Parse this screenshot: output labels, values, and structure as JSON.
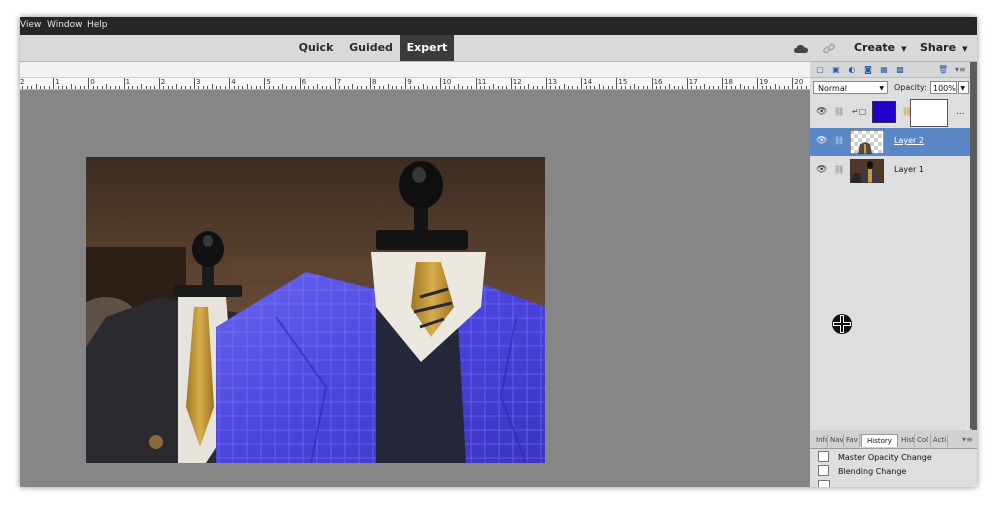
{
  "menu": [
    "View",
    "Window",
    "Help"
  ],
  "modes": {
    "quick": "Quick",
    "guided": "Guided",
    "expert": "Expert"
  },
  "top_actions": {
    "create": "Create",
    "share": "Share"
  },
  "ruler_labels": [
    "2",
    "1",
    "0",
    "1",
    "2",
    "3",
    "4",
    "5",
    "6",
    "7",
    "8",
    "9",
    "10",
    "11",
    "12",
    "13",
    "14",
    "15",
    "16",
    "17",
    "18",
    "19",
    "20"
  ],
  "layers_panel": {
    "blend_mode": "Normal",
    "opacity_label": "Opacity:",
    "opacity_value": "100%",
    "more": "...",
    "layers": [
      {
        "name": "",
        "type": "adjustment"
      },
      {
        "name": "Layer 2",
        "selected": true
      },
      {
        "name": "Layer 1",
        "selected": false
      }
    ]
  },
  "history_panel": {
    "close": "×",
    "tabs": [
      "Info",
      "Nav",
      "Fav",
      "History",
      "Hist",
      "Col",
      "Acti"
    ],
    "active_tab": "History",
    "items": [
      "Master Opacity Change",
      "Blending Change"
    ]
  },
  "icons": {
    "cloud": "cloud-icon",
    "link": "link-icon",
    "eye": "eye-icon",
    "trash": "trash-icon",
    "panel_menu": "panel-menu-icon"
  },
  "colors": {
    "menubar": "#262626",
    "modebar": "#d9d9d9",
    "active_mode": "#3b3b3b",
    "canvas": "#868686",
    "selected_layer": "#5a87c5",
    "fill_color": "#2200cc"
  }
}
